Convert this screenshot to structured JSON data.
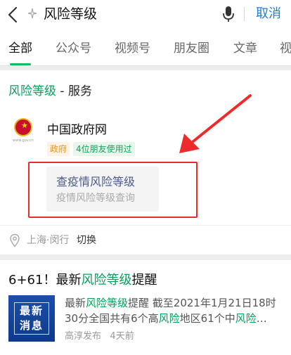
{
  "search": {
    "query": "风险等级",
    "cancel_label": "取消"
  },
  "tabs": [
    {
      "label": "全部",
      "active": true
    },
    {
      "label": "公众号"
    },
    {
      "label": "视频号"
    },
    {
      "label": "朋友圈"
    },
    {
      "label": "文章"
    },
    {
      "label": "视"
    }
  ],
  "service_card": {
    "heading_highlight": "风险等级",
    "heading_rest": " - 服务",
    "account": {
      "name": "中国政府网",
      "logo_text": "www.gov.cn",
      "badges": [
        "政府",
        "4位朋友使用过"
      ]
    },
    "service": {
      "title": "查疫情风险等级",
      "subtitle": "疫情风险等级查询"
    },
    "location": {
      "place": "上海·闵行",
      "switch_label": "切换"
    }
  },
  "article": {
    "title_prefix": "6+61！最新",
    "title_highlight": "风险等级",
    "title_suffix": "提醒",
    "thumb_lines": [
      "最新",
      "消息"
    ],
    "snippet_parts": [
      "最新",
      "风险等级",
      "提醒 截至2021年1月21日18时30分全国共有6个高",
      "风险",
      "地区61个中",
      "风险",
      "…"
    ],
    "source": "高淳发布",
    "time": "4天前"
  },
  "colors": {
    "accent_green": "#07c160",
    "link_blue": "#1a7fd4",
    "annotation_red": "#ee2b2b"
  }
}
